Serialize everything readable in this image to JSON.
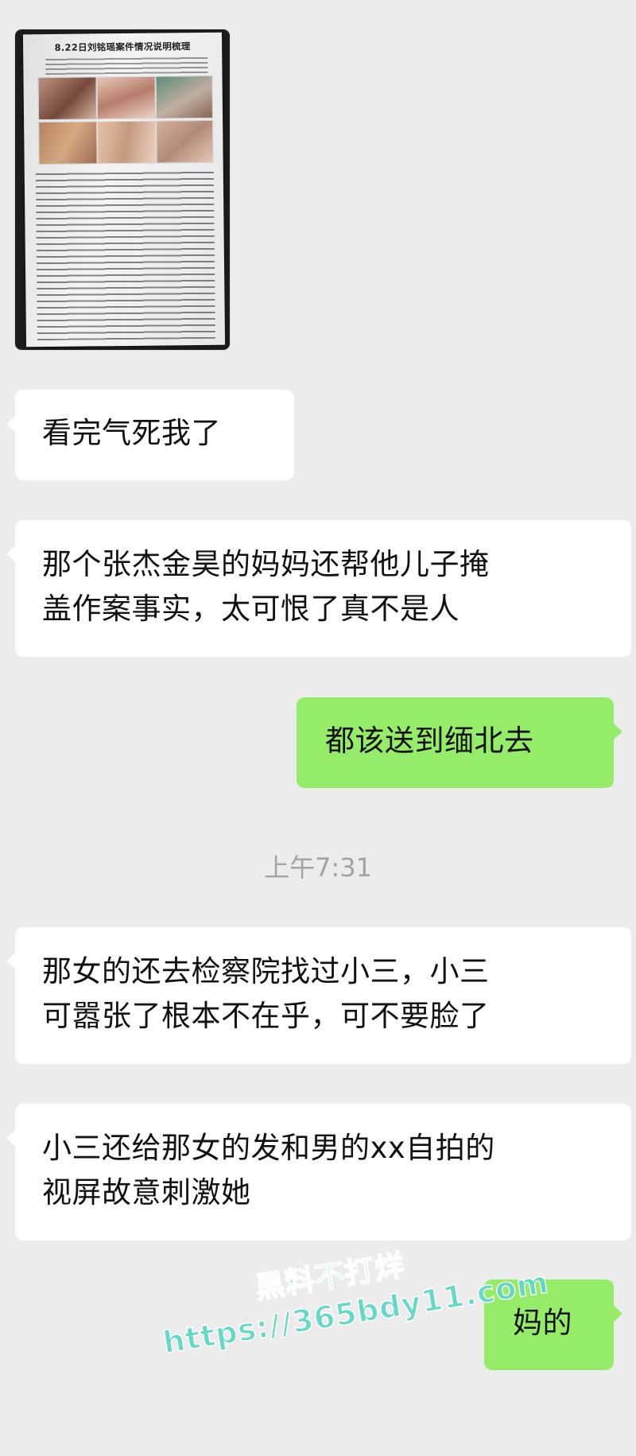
{
  "image_message": {
    "flyer_title": "8.22日刘铭瑶案件情况说明梳理"
  },
  "messages": [
    {
      "side": "left",
      "text": "看完气死我了"
    },
    {
      "side": "left",
      "text": "那个张杰金昊的妈妈还帮他儿子掩\n盖作案事实，太可恨了真不是人"
    },
    {
      "side": "right",
      "text": "都该送到缅北去"
    },
    {
      "side": "left",
      "text": "那女的还去检察院找过小三，小三\n可嚣张了根本不在乎，可不要脸了"
    },
    {
      "side": "left",
      "text": "小三还给那女的发和男的xx自拍的\n视屏故意刺激她"
    },
    {
      "side": "right",
      "text": "妈的"
    }
  ],
  "timestamp": "上午7:31",
  "watermark": {
    "line1": "黑料不打烊",
    "line2": "https://365bdy11.com"
  },
  "colors": {
    "background": "#ececec",
    "incoming_bubble": "#ffffff",
    "outgoing_bubble": "#95ec69",
    "timestamp_text": "#a3a3a3",
    "watermark": "#5fd9c4"
  }
}
